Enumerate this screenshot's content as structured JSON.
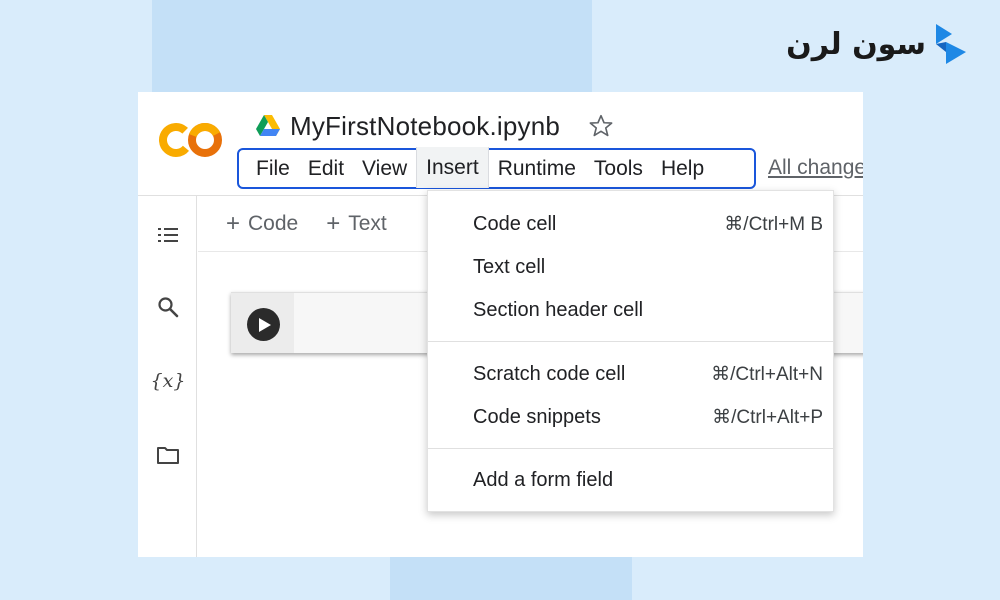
{
  "brand": {
    "text": "سون لرن"
  },
  "notebook": {
    "title": "MyFirstNotebook.ipynb"
  },
  "menubar": {
    "items": [
      "File",
      "Edit",
      "View",
      "Insert",
      "Runtime",
      "Tools",
      "Help"
    ],
    "active": "Insert",
    "status": "All changes saved"
  },
  "toolbar": {
    "code_label": "Code",
    "text_label": "Text"
  },
  "insert_menu": {
    "items": [
      {
        "label": "Code cell",
        "shortcut": "⌘/Ctrl+M B"
      },
      {
        "label": "Text cell",
        "shortcut": ""
      },
      {
        "label": "Section header cell",
        "shortcut": ""
      },
      {
        "label": "Scratch code cell",
        "shortcut": "⌘/Ctrl+Alt+N"
      },
      {
        "label": "Code snippets",
        "shortcut": "⌘/Ctrl+Alt+P"
      },
      {
        "label": "Add a form field",
        "shortcut": ""
      }
    ]
  },
  "sidebar": {
    "variables_icon_text": "{x}"
  },
  "colors": {
    "menubar_outline": "#1a56db",
    "colab_orange": "#f9ab00",
    "colab_orange_dark": "#e8710a",
    "background": "#d9ecfb"
  }
}
